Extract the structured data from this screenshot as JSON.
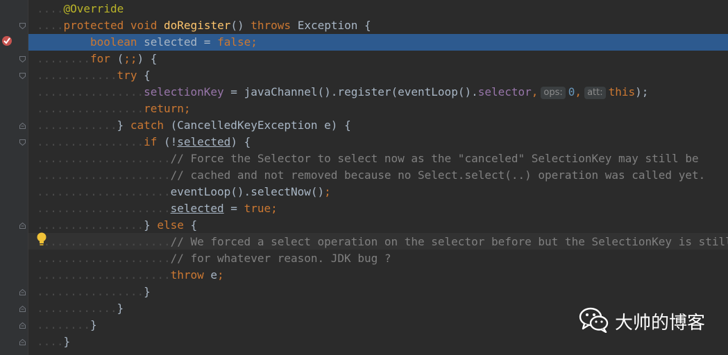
{
  "editor": {
    "lines": [
      {
        "t": [
          [
            "ann",
            "@Override"
          ]
        ]
      },
      {
        "t": [
          [
            "kw",
            "protected void "
          ],
          [
            "fn",
            "doRegister"
          ],
          [
            "p",
            "() "
          ],
          [
            "kw",
            "throws "
          ],
          [
            "p",
            "Exception {"
          ]
        ]
      },
      {
        "t": [
          [
            "kw",
            "boolean "
          ],
          [
            "p",
            "selected = "
          ],
          [
            "kw",
            "false;"
          ]
        ]
      },
      {
        "t": [
          [
            "kw",
            "for "
          ],
          [
            "p",
            "("
          ],
          [
            "kw",
            ";;"
          ],
          [
            "p",
            ") {"
          ]
        ]
      },
      {
        "t": [
          [
            "kw",
            "try "
          ],
          [
            "p",
            "{"
          ]
        ]
      },
      {
        "t": [
          [
            "fld",
            "selectionKey"
          ],
          [
            "p",
            " = javaChannel().register(eventLoop()."
          ],
          [
            "fld",
            "selector"
          ],
          [
            "kw",
            ","
          ],
          [
            "hint",
            "ops:"
          ],
          [
            "num",
            "0"
          ],
          [
            "kw",
            ","
          ],
          [
            "hint",
            "att:"
          ],
          [
            "kw",
            "this"
          ],
          [
            "p",
            ");"
          ]
        ]
      },
      {
        "t": [
          [
            "kw",
            "return;"
          ]
        ]
      },
      {
        "t": [
          [
            "p",
            "} "
          ],
          [
            "kw",
            "catch "
          ],
          [
            "p",
            "(CancelledKeyException e) {"
          ]
        ]
      },
      {
        "t": [
          [
            "kw",
            "if "
          ],
          [
            "p",
            "(!"
          ],
          [
            "ul",
            "selected"
          ],
          [
            "p",
            ") {"
          ]
        ]
      },
      {
        "t": [
          [
            "cmt",
            "// Force the Selector to select now as the \"canceled\" SelectionKey may still be"
          ]
        ]
      },
      {
        "t": [
          [
            "cmt",
            "// cached and not removed because no Select.select(..) operation was called yet."
          ]
        ]
      },
      {
        "t": [
          [
            "p",
            "eventLoop().selectNow()"
          ],
          [
            "kw",
            ";"
          ]
        ]
      },
      {
        "t": [
          [
            "ul",
            "selected"
          ],
          [
            "p",
            " = "
          ],
          [
            "kw",
            "true;"
          ]
        ]
      },
      {
        "t": [
          [
            "p",
            "} "
          ],
          [
            "kw",
            "else "
          ],
          [
            "p",
            "{"
          ]
        ]
      },
      {
        "t": [
          [
            "cmt",
            "// We forced a select operation on the selector before but the SelectionKey is still cac"
          ]
        ]
      },
      {
        "t": [
          [
            "cmt",
            "// for whatever reason. JDK bug ?"
          ]
        ]
      },
      {
        "t": [
          [
            "kw",
            "throw "
          ],
          [
            "p",
            "e"
          ],
          [
            "kw",
            ";"
          ]
        ]
      },
      {
        "t": [
          [
            "p",
            "}"
          ]
        ]
      },
      {
        "t": [
          [
            "p",
            "}"
          ]
        ]
      },
      {
        "t": [
          [
            "p",
            "}"
          ]
        ]
      },
      {
        "t": [
          [
            "p",
            "}"
          ]
        ]
      }
    ],
    "line_indent_levels": [
      1,
      1,
      2,
      2,
      3,
      4,
      4,
      3,
      4,
      5,
      5,
      5,
      5,
      4,
      5,
      5,
      5,
      4,
      3,
      2,
      1
    ],
    "highlighted_line_index": 2,
    "dot_glyph": ".",
    "colors": {
      "background": "#2b2b2b",
      "highlight": "#2d5a8f",
      "keyword": "#cc7832",
      "annotation": "#bbb529",
      "method": "#ffc66d",
      "field": "#9876aa",
      "number": "#6897bb",
      "comment": "#808080",
      "plain": "#a9b7c6"
    }
  },
  "gutter": {
    "breakpoint_icon": "breakpoint-icon",
    "intention_icon": "lightbulb-icon"
  },
  "watermark": {
    "icon": "wechat-icon",
    "text": "大帅的博客"
  }
}
